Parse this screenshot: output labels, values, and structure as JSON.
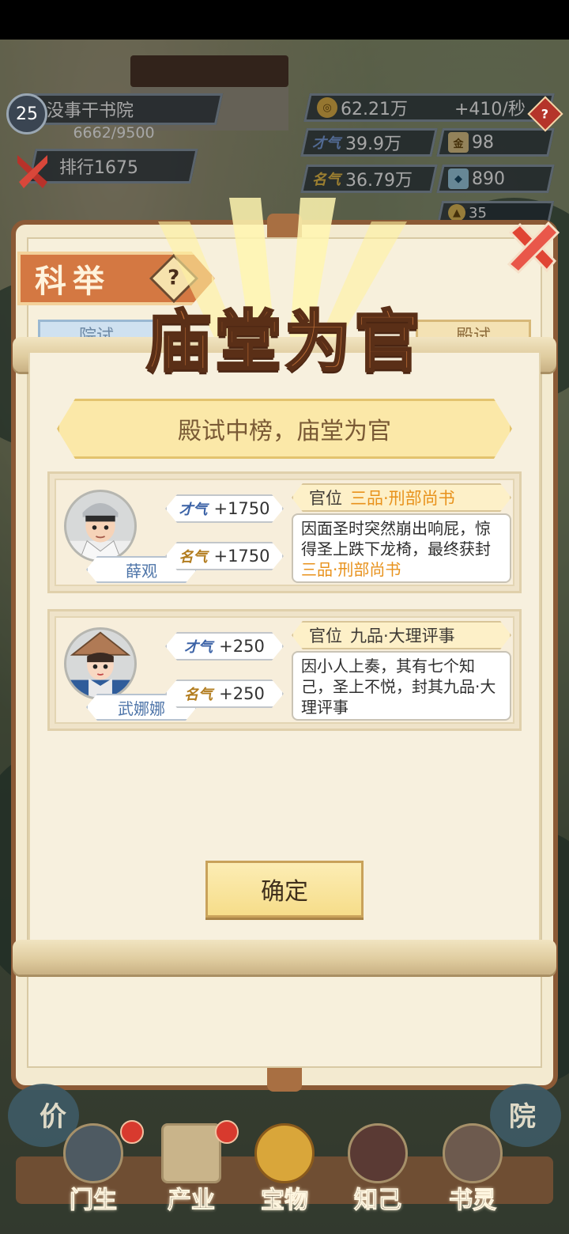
{
  "hud": {
    "level": "25",
    "academy_name": "没事干书院",
    "exp": "6662/9500",
    "rank": "排行1675",
    "coins": "62.21万",
    "coin_rate": "+410/秒",
    "talent_label": "才气",
    "talent_value": "39.9万",
    "fame_label": "名气",
    "fame_value": "36.79万",
    "res1_value": "98",
    "res2_value": "890",
    "res3_value": "35"
  },
  "panel": {
    "banner": "科举",
    "help": "?",
    "tab_left": "院试",
    "tab_right": "殿试"
  },
  "popup": {
    "title": "庙堂为官",
    "subtitle": "殿试中榜，庙堂为官",
    "confirm": "确定",
    "students": [
      {
        "name": "薛观",
        "talent_label": "才气",
        "talent": "+1750",
        "fame_label": "名气",
        "fame": "+1750",
        "post_label": "官位",
        "post": "三品·刑部尚书",
        "desc_pre": "因面圣时突然崩出响屁，惊得圣上跌下龙椅，最终获封",
        "desc_hl": "三品·刑部尚书"
      },
      {
        "name": "武娜娜",
        "talent_label": "才气",
        "talent": "+250",
        "fame_label": "名气",
        "fame": "+250",
        "post_label": "官位",
        "post": "九品·大理评事",
        "desc_pre": "因小人上奏，其有七个知己，圣上不悦，封其九品·大理评事",
        "desc_hl": ""
      }
    ]
  },
  "nav": {
    "items": [
      "门生",
      "产业",
      "宝物",
      "知己",
      "书灵"
    ],
    "left_edge": "价",
    "right_edge": "院"
  },
  "colors": {
    "highlight": "#e8921c",
    "title": "#b86a34",
    "banner": "#d47842"
  }
}
